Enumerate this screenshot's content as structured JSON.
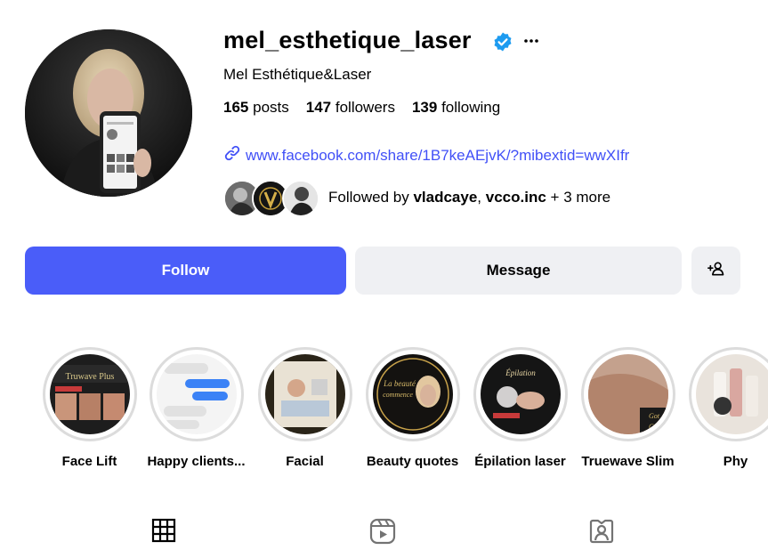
{
  "profile": {
    "username": "mel_esthetique_laser",
    "full_name": "Mel Esthétique&Laser",
    "verified": true,
    "stats": {
      "posts_count": "165",
      "posts_label": "posts",
      "followers_count": "147",
      "followers_label": "followers",
      "following_count": "139",
      "following_label": "following"
    },
    "link": "www.facebook.com/share/1B7keAEjvK/?mibextid=wwXIfr",
    "followed_by": {
      "prefix": "Followed by",
      "user1": "vladcaye",
      "separator": ",",
      "user2": "vcco.inc",
      "suffix": "+ 3 more"
    }
  },
  "actions": {
    "follow_label": "Follow",
    "message_label": "Message"
  },
  "highlights": [
    {
      "label": "Face Lift"
    },
    {
      "label": "Happy clients..."
    },
    {
      "label": "Facial"
    },
    {
      "label": "Beauty quotes"
    },
    {
      "label": "Épilation laser"
    },
    {
      "label": "Truewave Slim"
    },
    {
      "label": "Phy"
    }
  ],
  "colors": {
    "accent": "#4a5df9",
    "link": "#4150f7",
    "verified": "#1d9bf0",
    "button_secondary": "#eff0f3"
  },
  "icons": [
    "verified-icon",
    "more-options-icon",
    "link-icon",
    "add-person-icon",
    "grid-icon",
    "reels-icon",
    "tagged-icon"
  ]
}
